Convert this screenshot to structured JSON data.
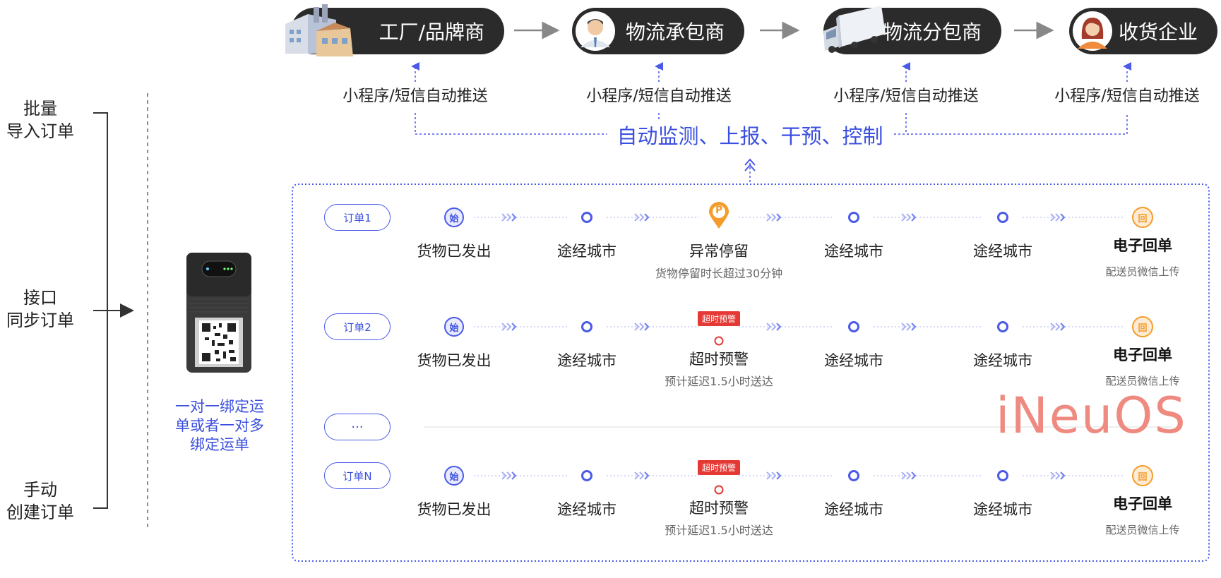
{
  "sources": [
    {
      "label": "批量\n导入订单"
    },
    {
      "label": "接口\n同步订单"
    },
    {
      "label": "手动\n创建订单"
    }
  ],
  "device_caption": "一对一绑定运\n单或者一对多\n绑定运单",
  "roles": [
    {
      "label": "工厂/品牌商",
      "icon": "factory-icon"
    },
    {
      "label": "物流承包商",
      "icon": "contractor-avatar-icon"
    },
    {
      "label": "物流分包商",
      "icon": "truck-icon"
    },
    {
      "label": "收货企业",
      "icon": "receiver-avatar-icon"
    }
  ],
  "push_label": "小程序/短信自动推送",
  "monitor_label": "自动监测、上报、干预、控制",
  "orders": [
    {
      "name": "订单1",
      "start": {
        "glyph": "始",
        "label": "货物已发出"
      },
      "city1": "途经城市",
      "event": {
        "type": "parking",
        "glyph": "P",
        "label": "异常停留",
        "sub": "货物停留时长超过30分钟"
      },
      "city2": "途经城市",
      "city3": "途经城市",
      "end": {
        "glyph": "回",
        "label": "电子回单",
        "sub": "配送员微信上传"
      }
    },
    {
      "name": "订单2",
      "start": {
        "glyph": "始",
        "label": "货物已发出"
      },
      "city1": "途经城市",
      "event": {
        "type": "alert",
        "badge": "超时预警",
        "label": "超时预警",
        "sub": "预计延迟1.5小时送达"
      },
      "city2": "途经城市",
      "city3": "途经城市",
      "end": {
        "glyph": "回",
        "label": "电子回单",
        "sub": "配送员微信上传"
      }
    },
    {
      "name": "···"
    },
    {
      "name": "订单N",
      "start": {
        "glyph": "始",
        "label": "货物已发出"
      },
      "city1": "途经城市",
      "event": {
        "type": "alert",
        "badge": "超时预警",
        "label": "超时预警",
        "sub": "预计延迟1.5小时送达"
      },
      "city2": "途经城市",
      "city3": "途经城市",
      "end": {
        "glyph": "回",
        "label": "电子回单",
        "sub": "配送员微信上传"
      }
    }
  ],
  "watermark": "iNeuOS",
  "colors": {
    "accent": "#3b4fe0",
    "alert": "#e53935",
    "parking": "#f39c2b",
    "pill": "#2b2b2b"
  }
}
